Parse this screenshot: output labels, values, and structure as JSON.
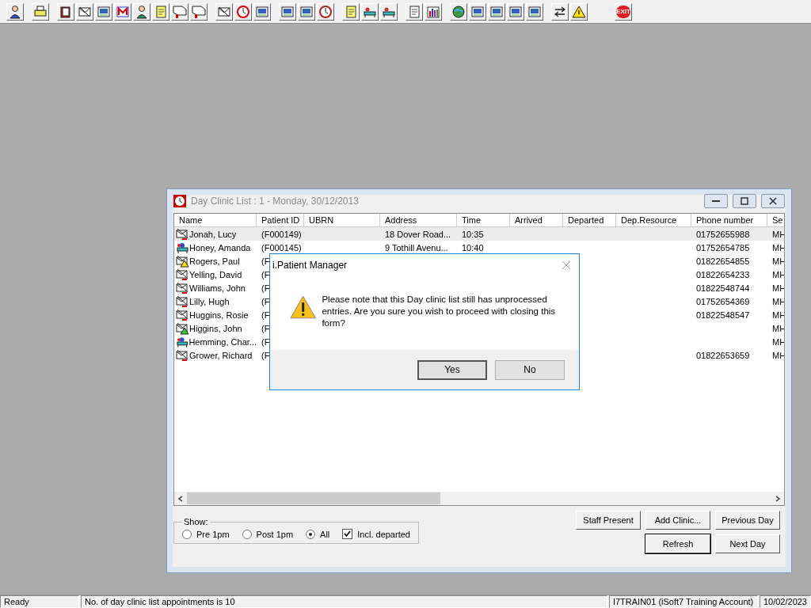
{
  "toolbar": {
    "exit_label": "EXIT"
  },
  "window": {
    "title": "Day Clinic List : 1 - Monday, 30/12/2013"
  },
  "table": {
    "columns": [
      "Name",
      "Patient ID",
      "UBRN",
      "Address",
      "Time",
      "Arrived",
      "Departed",
      "Dep.Resource",
      "Phone number",
      "Se"
    ],
    "rows": [
      {
        "kind": "letter",
        "selected": true,
        "cells": [
          "Jonah, Lucy",
          "(F000149)",
          "",
          "18 Dover Road...",
          "10:35",
          "",
          "",
          "",
          "01752655988",
          "MH"
        ]
      },
      {
        "kind": "patient",
        "selected": false,
        "cells": [
          "Honey, Amanda",
          "(F000145)",
          "",
          "9 Tothill Avenu...",
          "10:40",
          "",
          "",
          "",
          "01752654785",
          "MH"
        ]
      },
      {
        "kind": "letter-warning",
        "selected": false,
        "cells": [
          "Rogers, Paul",
          "(F",
          "",
          "",
          "",
          "",
          "",
          "",
          "01822654855",
          "MH"
        ]
      },
      {
        "kind": "letter",
        "selected": false,
        "cells": [
          "Yelling, David",
          "(F",
          "",
          "",
          "",
          "",
          "",
          "",
          "01822654233",
          "MH"
        ]
      },
      {
        "kind": "letter",
        "selected": false,
        "cells": [
          "Williams, John",
          "(F",
          "",
          "",
          "",
          "",
          "",
          "",
          "01822548744",
          "MH"
        ]
      },
      {
        "kind": "letter",
        "selected": false,
        "cells": [
          "Lilly, Hugh",
          "(F",
          "",
          "",
          "",
          "",
          "",
          "",
          "01752654369",
          "MH"
        ]
      },
      {
        "kind": "letter",
        "selected": false,
        "cells": [
          "Huggins, Rosie",
          "(F",
          "",
          "",
          "",
          "",
          "",
          "",
          "01822548547",
          "MH"
        ]
      },
      {
        "kind": "letter-alert",
        "selected": false,
        "cells": [
          "Higgins, John",
          "(F",
          "",
          "",
          "",
          "",
          "",
          "",
          "",
          "MH"
        ]
      },
      {
        "kind": "patient",
        "selected": false,
        "cells": [
          "Hemming, Char...",
          "(F",
          "",
          "",
          "",
          "",
          "",
          "",
          "",
          "MH"
        ]
      },
      {
        "kind": "letter",
        "selected": false,
        "cells": [
          "Grower, Richard",
          "(F",
          "",
          "",
          "",
          "",
          "",
          "",
          "01822653659",
          "MH"
        ]
      }
    ]
  },
  "show": {
    "label": "Show:",
    "options": [
      {
        "label": "Pre 1pm",
        "selected": false
      },
      {
        "label": "Post 1pm",
        "selected": false
      },
      {
        "label": "All",
        "selected": true
      }
    ],
    "incl_departed": {
      "label": "Incl. departed",
      "checked": true
    }
  },
  "buttons": [
    {
      "label": "Staff Present",
      "default": false
    },
    {
      "label": "Add Clinic...",
      "default": false
    },
    {
      "label": "Previous Day",
      "default": false
    },
    {
      "label": "Refresh",
      "default": true
    },
    {
      "label": "Next Day",
      "default": false
    }
  ],
  "dialog": {
    "title": "i.Patient Manager",
    "message": "Please note that this Day clinic list still has unprocessed entries. Are you sure you wish to proceed with closing this form?",
    "buttons": [
      {
        "label": "Yes",
        "default": true
      },
      {
        "label": "No",
        "default": false
      }
    ]
  },
  "status_bar": [
    "Ready",
    "No. of day clinic list appointments is 10",
    "I7TRAIN01 (iSoft7 Training Account)",
    "10/02/2023"
  ]
}
